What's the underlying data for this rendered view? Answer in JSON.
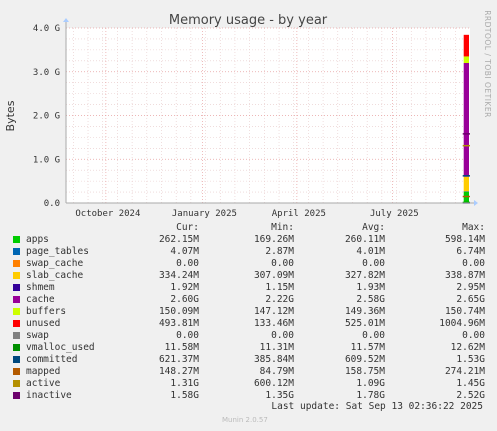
{
  "chart_data": {
    "type": "area",
    "title": "Memory usage - by year",
    "ylabel": "Bytes",
    "side_label": "RRDTOOL / TOBI OETIKER",
    "ylim": [
      0,
      4.0
    ],
    "y_unit": "G",
    "y_ticks": [
      "0.0",
      "1.0 G",
      "2.0 G",
      "3.0 G",
      "4.0 G"
    ],
    "y_tick_values": [
      0,
      1,
      2,
      3,
      4
    ],
    "x_ticks": [
      "October 2024",
      "January 2025",
      "April 2025",
      "July 2025"
    ],
    "x_tick_dates": [
      "2024-10-01",
      "2025-01-01",
      "2025-04-01",
      "2025-07-01"
    ],
    "x_range": [
      "2024-08-24",
      "2025-09-13"
    ],
    "data_start": "2025-09-07",
    "grid": true,
    "stack_order": [
      "apps",
      "page_tables",
      "swap_cache",
      "slab_cache",
      "cache",
      "buffers",
      "unused",
      "swap"
    ],
    "line_series": [
      "shmem",
      "vmalloc_used",
      "committed",
      "mapped",
      "active",
      "inactive"
    ],
    "columns": [
      "Cur:",
      "Min:",
      "Avg:",
      "Max:"
    ],
    "series": [
      {
        "name": "apps",
        "color": "#00cc00",
        "cur": "262.15M",
        "min": "169.26M",
        "avg": "260.11M",
        "max": "598.14M",
        "v": 0.262
      },
      {
        "name": "page_tables",
        "color": "#0066b3",
        "cur": "4.07M",
        "min": "2.87M",
        "avg": "4.01M",
        "max": "6.74M",
        "v": 0.004
      },
      {
        "name": "swap_cache",
        "color": "#ff8000",
        "cur": "0.00",
        "min": "0.00",
        "avg": "0.00",
        "max": "0.00",
        "v": 0
      },
      {
        "name": "slab_cache",
        "color": "#ffcc00",
        "cur": "334.24M",
        "min": "307.09M",
        "avg": "327.82M",
        "max": "338.87M",
        "v": 0.334
      },
      {
        "name": "shmem",
        "color": "#330099",
        "cur": "1.92M",
        "min": "1.15M",
        "avg": "1.93M",
        "max": "2.95M",
        "v": 0.002
      },
      {
        "name": "cache",
        "color": "#990099",
        "cur": "2.60G",
        "min": "2.22G",
        "avg": "2.58G",
        "max": "2.65G",
        "v": 2.6
      },
      {
        "name": "buffers",
        "color": "#ccff00",
        "cur": "150.09M",
        "min": "147.12M",
        "avg": "149.36M",
        "max": "150.74M",
        "v": 0.15
      },
      {
        "name": "unused",
        "color": "#ff0000",
        "cur": "493.81M",
        "min": "133.46M",
        "avg": "525.01M",
        "max": "1004.96M",
        "v": 0.494
      },
      {
        "name": "swap",
        "color": "#808080",
        "cur": "0.00",
        "min": "0.00",
        "avg": "0.00",
        "max": "0.00",
        "v": 0
      },
      {
        "name": "vmalloc_used",
        "color": "#008f00",
        "cur": "11.58M",
        "min": "11.31M",
        "avg": "11.57M",
        "max": "12.62M",
        "v": 0.012
      },
      {
        "name": "committed",
        "color": "#00487d",
        "cur": "621.37M",
        "min": "385.84M",
        "avg": "609.52M",
        "max": "1.53G",
        "v": 0.621
      },
      {
        "name": "mapped",
        "color": "#b35a00",
        "cur": "148.27M",
        "min": "84.79M",
        "avg": "158.75M",
        "max": "274.21M",
        "v": 0.148
      },
      {
        "name": "active",
        "color": "#b38f00",
        "cur": "1.31G",
        "min": "600.12M",
        "avg": "1.09G",
        "max": "1.45G",
        "v": 1.31
      },
      {
        "name": "inactive",
        "color": "#6b006b",
        "cur": "1.58G",
        "min": "1.35G",
        "avg": "1.78G",
        "max": "2.52G",
        "v": 1.58
      }
    ],
    "last_update": "Last update: Sat Sep 13 02:36:22 2025",
    "version": "Munin 2.0.57"
  }
}
